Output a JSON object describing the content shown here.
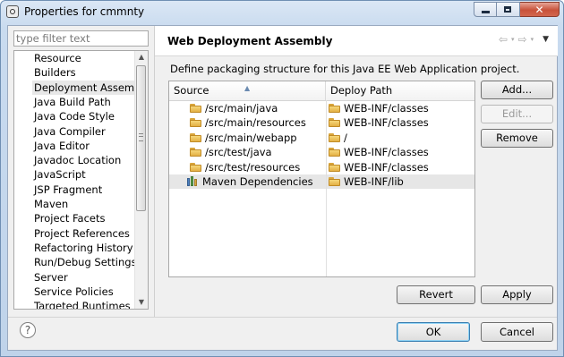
{
  "window": {
    "title": "Properties for cmmnty",
    "close_glyph": "✕"
  },
  "filter": {
    "placeholder": "type filter text"
  },
  "tree": {
    "items": [
      {
        "label": "Resource"
      },
      {
        "label": "Builders"
      },
      {
        "label": "Deployment Assembly",
        "selected": true
      },
      {
        "label": "Java Build Path"
      },
      {
        "label": "Java Code Style"
      },
      {
        "label": "Java Compiler"
      },
      {
        "label": "Java Editor"
      },
      {
        "label": "Javadoc Location"
      },
      {
        "label": "JavaScript"
      },
      {
        "label": "JSP Fragment"
      },
      {
        "label": "Maven"
      },
      {
        "label": "Project Facets"
      },
      {
        "label": "Project References"
      },
      {
        "label": "Refactoring History"
      },
      {
        "label": "Run/Debug Settings"
      },
      {
        "label": "Server"
      },
      {
        "label": "Service Policies"
      },
      {
        "label": "Targeted Runtimes"
      }
    ]
  },
  "page": {
    "title": "Web Deployment Assembly",
    "nav": {
      "back": "⇦",
      "forward": "⇨",
      "dropdown": "▾",
      "menu": "▼"
    },
    "description": "Define packaging structure for this Java EE Web Application project."
  },
  "table": {
    "columns": {
      "source": "Source",
      "deploy": "Deploy Path"
    },
    "rows": [
      {
        "source": "/src/main/java",
        "deploy": "WEB-INF/classes",
        "icon": "folder-icon"
      },
      {
        "source": "/src/main/resources",
        "deploy": "WEB-INF/classes",
        "icon": "folder-icon"
      },
      {
        "source": "/src/main/webapp",
        "deploy": "/",
        "icon": "folder-icon"
      },
      {
        "source": "/src/test/java",
        "deploy": "WEB-INF/classes",
        "icon": "folder-icon"
      },
      {
        "source": "/src/test/resources",
        "deploy": "WEB-INF/classes",
        "icon": "folder-icon"
      },
      {
        "source": "Maven Dependencies",
        "deploy": "WEB-INF/lib",
        "icon": "library-icon",
        "selected": true
      }
    ]
  },
  "buttons": {
    "add": "Add...",
    "edit": "Edit...",
    "remove": "Remove",
    "revert": "Revert",
    "apply": "Apply",
    "ok": "OK",
    "cancel": "Cancel"
  },
  "help": {
    "glyph": "?"
  },
  "colors": {
    "title_gradient": "#c9dbef",
    "selection": "#e8e8e8",
    "folder": "#e3b045",
    "default_button_border": "#3c7fb1"
  }
}
